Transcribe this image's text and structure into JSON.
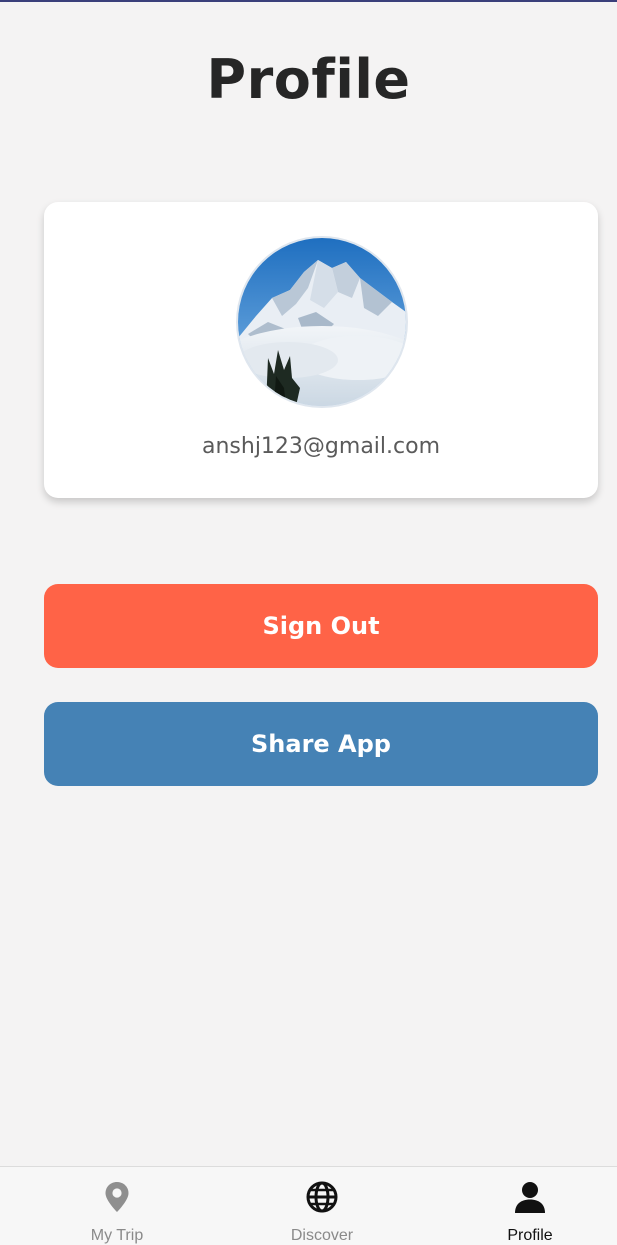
{
  "header": {
    "title": "Profile"
  },
  "profile": {
    "email": "anshj123@gmail.com",
    "avatar": "mountain-photo"
  },
  "actions": {
    "sign_out_label": "Sign Out",
    "share_app_label": "Share App"
  },
  "bottom_nav": {
    "items": [
      {
        "label": "My Trip",
        "icon": "map-pin-icon",
        "active": false
      },
      {
        "label": "Discover",
        "icon": "globe-icon",
        "active": false
      },
      {
        "label": "Profile",
        "icon": "user-icon",
        "active": true
      }
    ]
  },
  "colors": {
    "background": "#f4f3f3",
    "sign_out": "#ff6347",
    "share_app": "#4582b5",
    "title": "#262626"
  }
}
